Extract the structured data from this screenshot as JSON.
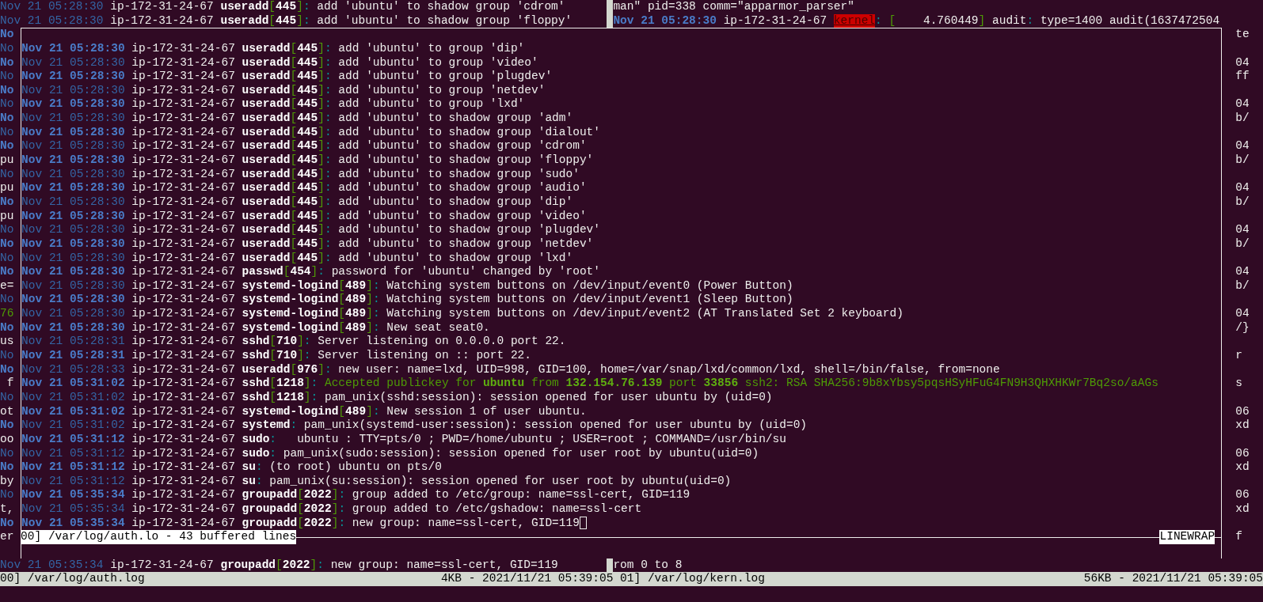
{
  "top_panes": {
    "left": [
      {
        "date": "Nov 21 05:28:30",
        "date_bold": false,
        "host": "ip-172-31-24-67",
        "process": "useradd",
        "open": "[",
        "pid": "445",
        "close": "]",
        "colon": ":",
        "message": "add 'ubuntu' to shadow group 'cdrom'"
      },
      {
        "date": "Nov 21 05:28:30",
        "date_bold": false,
        "host": "ip-172-31-24-67",
        "process": "useradd",
        "open": "[",
        "pid": "445",
        "close": "]",
        "colon": ":",
        "message": "add 'ubuntu' to shadow group 'floppy'"
      }
    ],
    "right": [
      {
        "message": "man\" pid=338 comm=\"apparmor_parser\""
      },
      {
        "date": "Nov 21 05:28:30",
        "date_bold": true,
        "host": "ip-172-31-24-67",
        "parts": [
          {
            "kind": "alert",
            "text": "kernel"
          },
          {
            "kind": "sep",
            "text": ":"
          },
          {
            "kind": "bracket",
            "text": "["
          },
          {
            "kind": "text",
            "text": "    4.760449"
          },
          {
            "kind": "bracket",
            "text": "]"
          },
          {
            "kind": "text",
            "text": " audit"
          },
          {
            "kind": "sep",
            "text": ":"
          },
          {
            "kind": "text",
            "text": "type=1400 audit(1637472504"
          }
        ]
      }
    ]
  },
  "left_edge": [
    {
      "text": "No",
      "kind": "date_bold"
    },
    {
      "text": "No",
      "kind": "date"
    },
    {
      "text": "No",
      "kind": "date_bold"
    },
    {
      "text": "No",
      "kind": "date"
    },
    {
      "text": "No",
      "kind": "date_bold"
    },
    {
      "text": "No",
      "kind": "date"
    },
    {
      "text": "No",
      "kind": "date_bold"
    },
    {
      "text": "No",
      "kind": "date"
    },
    {
      "text": "No",
      "kind": "date_bold"
    },
    {
      "text": "pu",
      "kind": "text"
    },
    {
      "text": "No",
      "kind": "date"
    },
    {
      "text": "pu",
      "kind": "text"
    },
    {
      "text": "No",
      "kind": "date_bold"
    },
    {
      "text": "pu",
      "kind": "text"
    },
    {
      "text": "No",
      "kind": "date"
    },
    {
      "text": "No",
      "kind": "date_bold"
    },
    {
      "text": "No",
      "kind": "date"
    },
    {
      "text": "No",
      "kind": "date_bold"
    },
    {
      "text": "e=",
      "kind": "text"
    },
    {
      "text": "No",
      "kind": "date"
    },
    {
      "text": "76",
      "kind": "ok"
    },
    {
      "text": "No",
      "kind": "date_bold"
    },
    {
      "text": "us",
      "kind": "text"
    },
    {
      "text": "No",
      "kind": "date"
    },
    {
      "text": "No",
      "kind": "date_bold"
    },
    {
      "text": "f",
      "kind": "text"
    },
    {
      "text": "No",
      "kind": "date"
    },
    {
      "text": "ot",
      "kind": "text"
    },
    {
      "text": "No",
      "kind": "date_bold"
    },
    {
      "text": "oo",
      "kind": "text"
    },
    {
      "text": "No",
      "kind": "date"
    },
    {
      "text": "No",
      "kind": "date_bold"
    },
    {
      "text": "by",
      "kind": "text"
    },
    {
      "text": "No",
      "kind": "date"
    },
    {
      "text": "t,",
      "kind": "text"
    },
    {
      "text": "No",
      "kind": "date_bold"
    },
    {
      "text": "er",
      "kind": "text"
    }
  ],
  "popup": {
    "lines": [
      {
        "date": "Nov 21 05:28:30",
        "date_bold": true,
        "host": "ip-172-31-24-67",
        "process": "useradd",
        "open": "[",
        "pid": "445",
        "close": "]",
        "colon": ":",
        "message": "add 'ubuntu' to group 'dip'"
      },
      {
        "date": "Nov 21 05:28:30",
        "date_bold": false,
        "host": "ip-172-31-24-67",
        "process": "useradd",
        "open": "[",
        "pid": "445",
        "close": "]",
        "colon": ":",
        "message": "add 'ubuntu' to group 'video'"
      },
      {
        "date": "Nov 21 05:28:30",
        "date_bold": true,
        "host": "ip-172-31-24-67",
        "process": "useradd",
        "open": "[",
        "pid": "445",
        "close": "]",
        "colon": ":",
        "message": "add 'ubuntu' to group 'plugdev'"
      },
      {
        "date": "Nov 21 05:28:30",
        "date_bold": false,
        "host": "ip-172-31-24-67",
        "process": "useradd",
        "open": "[",
        "pid": "445",
        "close": "]",
        "colon": ":",
        "message": "add 'ubuntu' to group 'netdev'"
      },
      {
        "date": "Nov 21 05:28:30",
        "date_bold": true,
        "host": "ip-172-31-24-67",
        "process": "useradd",
        "open": "[",
        "pid": "445",
        "close": "]",
        "colon": ":",
        "message": "add 'ubuntu' to group 'lxd'"
      },
      {
        "date": "Nov 21 05:28:30",
        "date_bold": false,
        "host": "ip-172-31-24-67",
        "process": "useradd",
        "open": "[",
        "pid": "445",
        "close": "]",
        "colon": ":",
        "message": "add 'ubuntu' to shadow group 'adm'"
      },
      {
        "date": "Nov 21 05:28:30",
        "date_bold": true,
        "host": "ip-172-31-24-67",
        "process": "useradd",
        "open": "[",
        "pid": "445",
        "close": "]",
        "colon": ":",
        "message": "add 'ubuntu' to shadow group 'dialout'"
      },
      {
        "date": "Nov 21 05:28:30",
        "date_bold": false,
        "host": "ip-172-31-24-67",
        "process": "useradd",
        "open": "[",
        "pid": "445",
        "close": "]",
        "colon": ":",
        "message": "add 'ubuntu' to shadow group 'cdrom'"
      },
      {
        "date": "Nov 21 05:28:30",
        "date_bold": true,
        "host": "ip-172-31-24-67",
        "process": "useradd",
        "open": "[",
        "pid": "445",
        "close": "]",
        "colon": ":",
        "message": "add 'ubuntu' to shadow group 'floppy'"
      },
      {
        "date": "Nov 21 05:28:30",
        "date_bold": false,
        "host": "ip-172-31-24-67",
        "process": "useradd",
        "open": "[",
        "pid": "445",
        "close": "]",
        "colon": ":",
        "message": "add 'ubuntu' to shadow group 'sudo'"
      },
      {
        "date": "Nov 21 05:28:30",
        "date_bold": true,
        "host": "ip-172-31-24-67",
        "process": "useradd",
        "open": "[",
        "pid": "445",
        "close": "]",
        "colon": ":",
        "message": "add 'ubuntu' to shadow group 'audio'"
      },
      {
        "date": "Nov 21 05:28:30",
        "date_bold": false,
        "host": "ip-172-31-24-67",
        "process": "useradd",
        "open": "[",
        "pid": "445",
        "close": "]",
        "colon": ":",
        "message": "add 'ubuntu' to shadow group 'dip'"
      },
      {
        "date": "Nov 21 05:28:30",
        "date_bold": true,
        "host": "ip-172-31-24-67",
        "process": "useradd",
        "open": "[",
        "pid": "445",
        "close": "]",
        "colon": ":",
        "message": "add 'ubuntu' to shadow group 'video'"
      },
      {
        "date": "Nov 21 05:28:30",
        "date_bold": false,
        "host": "ip-172-31-24-67",
        "process": "useradd",
        "open": "[",
        "pid": "445",
        "close": "]",
        "colon": ":",
        "message": "add 'ubuntu' to shadow group 'plugdev'"
      },
      {
        "date": "Nov 21 05:28:30",
        "date_bold": true,
        "host": "ip-172-31-24-67",
        "process": "useradd",
        "open": "[",
        "pid": "445",
        "close": "]",
        "colon": ":",
        "message": "add 'ubuntu' to shadow group 'netdev'"
      },
      {
        "date": "Nov 21 05:28:30",
        "date_bold": false,
        "host": "ip-172-31-24-67",
        "process": "useradd",
        "open": "[",
        "pid": "445",
        "close": "]",
        "colon": ":",
        "message": "add 'ubuntu' to shadow group 'lxd'"
      },
      {
        "date": "Nov 21 05:28:30",
        "date_bold": true,
        "host": "ip-172-31-24-67",
        "process": "passwd",
        "open": "[",
        "pid": "454",
        "close": "]",
        "colon": ":",
        "message": "password for 'ubuntu' changed by 'root'"
      },
      {
        "date": "Nov 21 05:28:30",
        "date_bold": false,
        "host": "ip-172-31-24-67",
        "process": "systemd-logind",
        "open": "[",
        "pid": "489",
        "close": "]",
        "colon": ":",
        "message": "Watching system buttons on /dev/input/event0 (Power Button)"
      },
      {
        "date": "Nov 21 05:28:30",
        "date_bold": true,
        "host": "ip-172-31-24-67",
        "process": "systemd-logind",
        "open": "[",
        "pid": "489",
        "close": "]",
        "colon": ":",
        "message": "Watching system buttons on /dev/input/event1 (Sleep Button)"
      },
      {
        "date": "Nov 21 05:28:30",
        "date_bold": false,
        "host": "ip-172-31-24-67",
        "process": "systemd-logind",
        "open": "[",
        "pid": "489",
        "close": "]",
        "colon": ":",
        "message": "Watching system buttons on /dev/input/event2 (AT Translated Set 2 keyboard)"
      },
      {
        "date": "Nov 21 05:28:30",
        "date_bold": true,
        "host": "ip-172-31-24-67",
        "process": "systemd-logind",
        "open": "[",
        "pid": "489",
        "close": "]",
        "colon": ":",
        "message": "New seat seat0."
      },
      {
        "date": "Nov 21 05:28:31",
        "date_bold": false,
        "host": "ip-172-31-24-67",
        "process": "sshd",
        "open": "[",
        "pid": "710",
        "close": "]",
        "colon": ":",
        "message": "Server listening on 0.0.0.0 port 22."
      },
      {
        "date": "Nov 21 05:28:31",
        "date_bold": true,
        "host": "ip-172-31-24-67",
        "process": "sshd",
        "open": "[",
        "pid": "710",
        "close": "]",
        "colon": ":",
        "message": "Server listening on :: port 22."
      },
      {
        "date": "Nov 21 05:28:33",
        "date_bold": false,
        "host": "ip-172-31-24-67",
        "process": "useradd",
        "open": "[",
        "pid": "976",
        "close": "]",
        "colon": ":",
        "message": "new user: name=lxd, UID=998, GID=100, home=/var/snap/lxd/common/lxd, shell=/bin/false, from=none"
      },
      {
        "date": "Nov 21 05:31:02",
        "date_bold": true,
        "host": "ip-172-31-24-67",
        "process": "sshd",
        "open": "[",
        "pid": "1218",
        "close": "]",
        "colon": ":",
        "parts": [
          {
            "kind": "ok",
            "text": "Accepted publickey for "
          },
          {
            "kind": "ok_bold",
            "text": "ubuntu"
          },
          {
            "kind": "ok",
            "text": " from "
          },
          {
            "kind": "ok_bold",
            "text": "132.154.76.139"
          },
          {
            "kind": "ok",
            "text": " port "
          },
          {
            "kind": "ok_bold",
            "text": "33856"
          },
          {
            "kind": "ok",
            "text": " ssh2: RSA SHA256:9b8xYbsy5pqsHSyHFuG4FN9H3QHXHKWr7Bq2so/aAGs"
          }
        ]
      },
      {
        "date": "Nov 21 05:31:02",
        "date_bold": false,
        "host": "ip-172-31-24-67",
        "process": "sshd",
        "open": "[",
        "pid": "1218",
        "close": "]",
        "colon": ":",
        "message": "pam_unix(sshd:session): session opened for user ubuntu by (uid=0)"
      },
      {
        "date": "Nov 21 05:31:02",
        "date_bold": true,
        "host": "ip-172-31-24-67",
        "process": "systemd-logind",
        "open": "[",
        "pid": "489",
        "close": "]",
        "colon": ":",
        "message": "New session 1 of user ubuntu."
      },
      {
        "date": "Nov 21 05:31:02",
        "date_bold": false,
        "host": "ip-172-31-24-67",
        "process": "systemd",
        "colon": ":",
        "message": "pam_unix(systemd-user:session): session opened for user ubuntu by (uid=0)"
      },
      {
        "date": "Nov 21 05:31:12",
        "date_bold": true,
        "host": "ip-172-31-24-67",
        "process": "sudo",
        "colon": ":",
        "message": "  ubuntu : TTY=pts/0 ; PWD=/home/ubuntu ; USER=root ; COMMAND=/usr/bin/su"
      },
      {
        "date": "Nov 21 05:31:12",
        "date_bold": false,
        "host": "ip-172-31-24-67",
        "process": "sudo",
        "colon": ":",
        "message": "pam_unix(sudo:session): session opened for user root by ubuntu(uid=0)"
      },
      {
        "date": "Nov 21 05:31:12",
        "date_bold": true,
        "host": "ip-172-31-24-67",
        "process": "su",
        "colon": ":",
        "message": "(to root) ubuntu on pts/0"
      },
      {
        "date": "Nov 21 05:31:12",
        "date_bold": false,
        "host": "ip-172-31-24-67",
        "process": "su",
        "colon": ":",
        "message": "pam_unix(su:session): session opened for user root by ubuntu(uid=0)"
      },
      {
        "date": "Nov 21 05:35:34",
        "date_bold": true,
        "host": "ip-172-31-24-67",
        "process": "groupadd",
        "open": "[",
        "pid": "2022",
        "close": "]",
        "colon": ":",
        "message": "group added to /etc/group: name=ssl-cert, GID=119"
      },
      {
        "date": "Nov 21 05:35:34",
        "date_bold": false,
        "host": "ip-172-31-24-67",
        "process": "groupadd",
        "open": "[",
        "pid": "2022",
        "close": "]",
        "colon": ":",
        "message": "group added to /etc/gshadow: name=ssl-cert"
      },
      {
        "date": "Nov 21 05:35:34",
        "date_bold": true,
        "host": "ip-172-31-24-67",
        "process": "groupadd",
        "open": "[",
        "pid": "2022",
        "close": "]",
        "colon": ":",
        "message": "new group: name=ssl-cert, GID=119",
        "cursor": true
      }
    ],
    "label": "00] /var/log/auth.lo - 43 buffered lines",
    "mode": "LINEWRAP"
  },
  "right_edge": [
    [
      "te"
    ],
    [
      "04",
      "ff"
    ],
    [
      "04",
      "b/"
    ],
    [
      "04",
      "b/"
    ],
    [
      "04",
      "b/"
    ],
    [
      "04",
      "b/"
    ],
    [
      "04",
      "b/"
    ],
    [
      "04",
      "/}"
    ],
    [
      "r"
    ],
    [
      "s"
    ],
    [
      "06",
      "xd"
    ],
    [
      "06",
      "xd"
    ],
    [
      "06",
      "xd"
    ],
    [
      "f"
    ]
  ],
  "bottom_panes": {
    "left": {
      "date": "Nov 21 05:35:34",
      "date_bold": false,
      "host": "ip-172-31-24-67",
      "process": "groupadd",
      "open": "[",
      "pid": "2022",
      "close": "]",
      "colon": ":",
      "message": "new group: name=ssl-cert, GID=119"
    },
    "right": {
      "message": "rom 0 to 8"
    }
  },
  "status_bar": [
    {
      "file": "00] /var/log/auth.log",
      "info": "4KB - 2021/11/21 05:39:05"
    },
    {
      "file": "01] /var/log/kern.log",
      "info": "56KB - 2021/11/21 05:39:05"
    }
  ]
}
